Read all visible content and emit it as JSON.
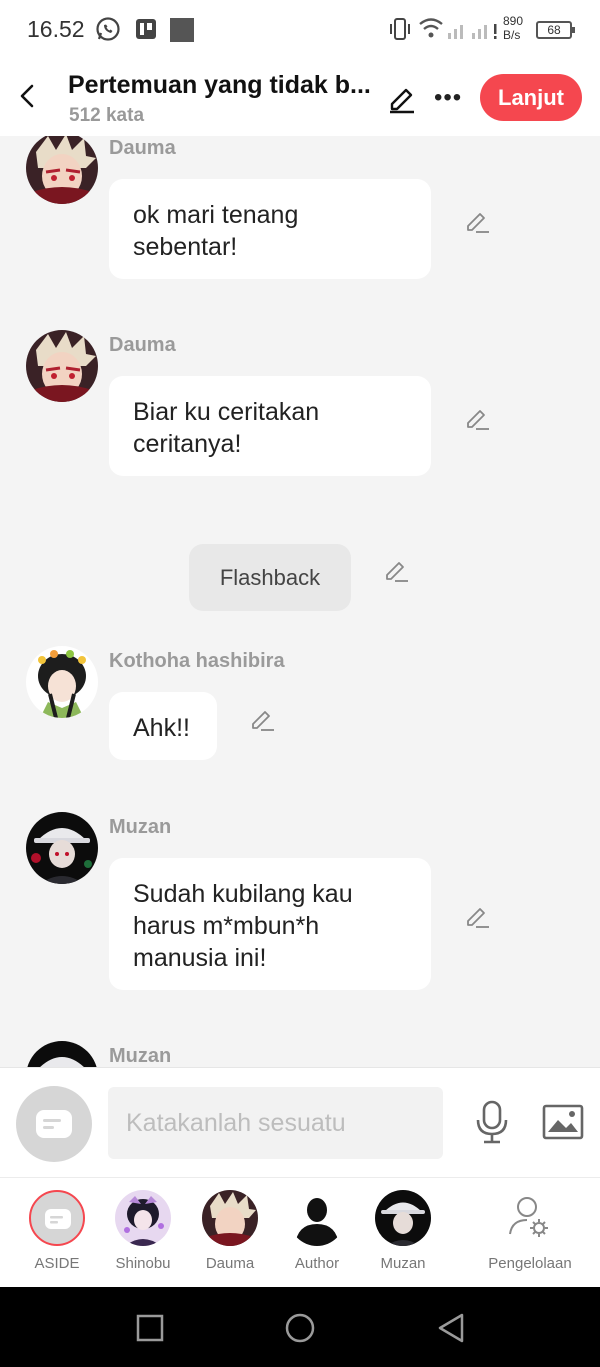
{
  "status": {
    "time": "16.52",
    "speed_value": "890",
    "speed_unit": "B/s",
    "battery": "68"
  },
  "header": {
    "title": "Pertemuan yang tidak b...",
    "word_count": "512 kata",
    "next_label": "Lanjut"
  },
  "messages": [
    {
      "name": "Dauma",
      "text": "ok mari tenang sebentar!"
    },
    {
      "name": "Dauma",
      "text": "Biar ku ceritakan ceritanya!"
    },
    {
      "narration": "Flashback"
    },
    {
      "name": "Kothoha hashibira",
      "text": "Ahk!!"
    },
    {
      "name": "Muzan",
      "text": "Sudah kubilang kau harus m*mbun*h manusia ini!"
    },
    {
      "name": "Muzan"
    }
  ],
  "composer": {
    "placeholder": "Katakanlah sesuatu"
  },
  "characters": [
    {
      "label": "ASIDE",
      "icon": "aside-chat-icon"
    },
    {
      "label": "Shinobu",
      "icon": "avatar"
    },
    {
      "label": "Dauma",
      "icon": "avatar"
    },
    {
      "label": "Author",
      "icon": "silhouette-avatar"
    },
    {
      "label": "Muzan",
      "icon": "avatar"
    },
    {
      "label": "Pengelolaan",
      "icon": "user-settings-icon"
    }
  ],
  "colors": {
    "accent": "#f5474f",
    "background": "#f4f4f4",
    "name": "#9a9a9a"
  }
}
